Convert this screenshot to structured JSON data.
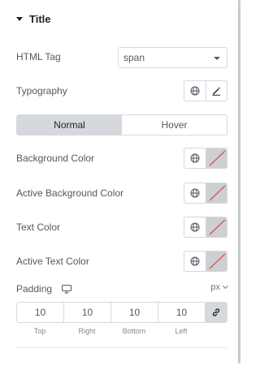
{
  "section": {
    "title": "Title"
  },
  "html_tag": {
    "label": "HTML Tag",
    "value": "span"
  },
  "typography": {
    "label": "Typography"
  },
  "state_tabs": [
    {
      "label": "Normal",
      "active": true
    },
    {
      "label": "Hover",
      "active": false
    }
  ],
  "color_controls": [
    {
      "label": "Background Color"
    },
    {
      "label": "Active Background Color"
    },
    {
      "label": "Text Color"
    },
    {
      "label": "Active Text Color"
    }
  ],
  "padding": {
    "label": "Padding",
    "unit": "px",
    "values": [
      "10",
      "10",
      "10",
      "10"
    ],
    "sides": [
      "Top",
      "Right",
      "Bottom",
      "Left"
    ]
  },
  "colors": {
    "swatch_bg": "#cdcfd2",
    "clear_line": "#d9534f",
    "active_tab": "#d5d8dc"
  }
}
